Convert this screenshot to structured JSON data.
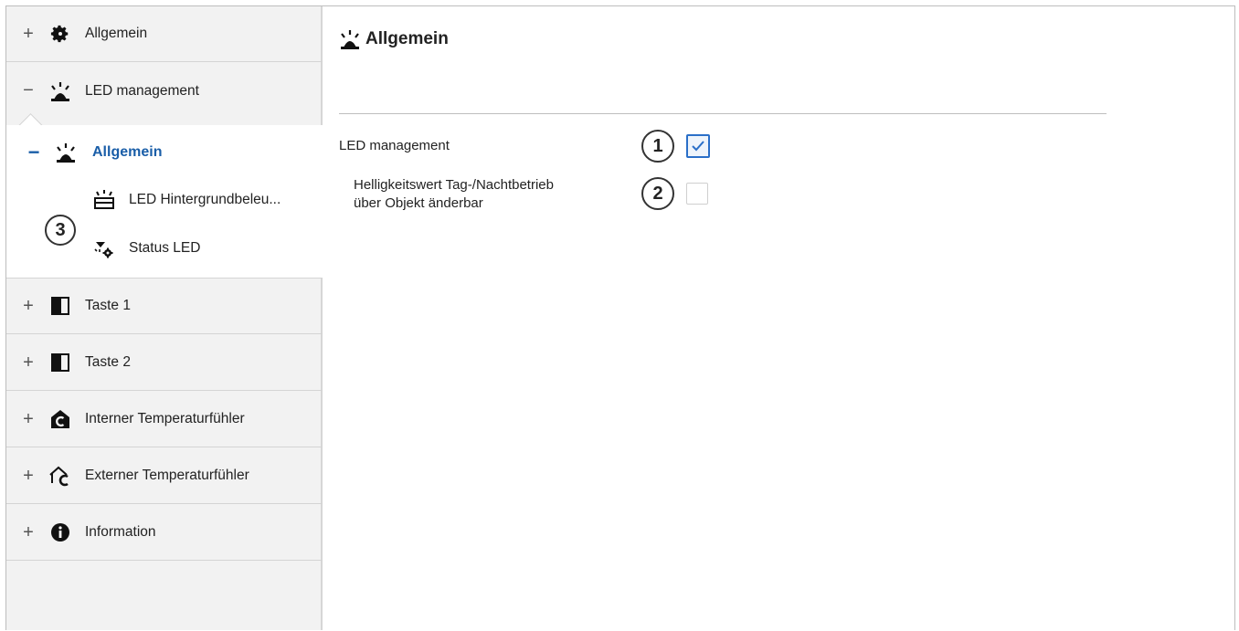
{
  "sidebar": {
    "items": [
      {
        "expander": "+",
        "icon": "gear-icon",
        "label": "Allgemein"
      },
      {
        "expander": "−",
        "icon": "led-light-icon",
        "label": "LED management"
      },
      {
        "expander": "+",
        "icon": "button-panel-icon",
        "label": "Taste 1"
      },
      {
        "expander": "+",
        "icon": "button-panel-icon",
        "label": "Taste 2"
      },
      {
        "expander": "+",
        "icon": "internal-temperature-icon",
        "label": "Interner Temperaturfühler"
      },
      {
        "expander": "+",
        "icon": "external-temperature-icon",
        "label": "Externer Temperaturfühler"
      },
      {
        "expander": "+",
        "icon": "info-icon",
        "label": "Information"
      }
    ],
    "selected": {
      "expander": "−",
      "icon": "led-light-icon",
      "label": "Allgemein"
    },
    "subitems": [
      {
        "icon": "led-backlight-icon",
        "label": "LED Hintergrundbeleu..."
      },
      {
        "icon": "status-led-icon",
        "label": "Status LED"
      }
    ]
  },
  "content": {
    "title_icon": "led-light-icon",
    "title": "Allgemein",
    "params": [
      {
        "label": "LED management",
        "checked": true
      },
      {
        "label_line1": "Helligkeitswert Tag-/Nachtbetrieb",
        "label_line2": "über Objekt änderbar",
        "checked": false
      }
    ]
  },
  "callouts": [
    "1",
    "2",
    "3"
  ],
  "colors": {
    "accent": "#1a5ea8",
    "checkbox_border": "#2a6fc8",
    "sidebar_bg": "#f2f2f2"
  }
}
